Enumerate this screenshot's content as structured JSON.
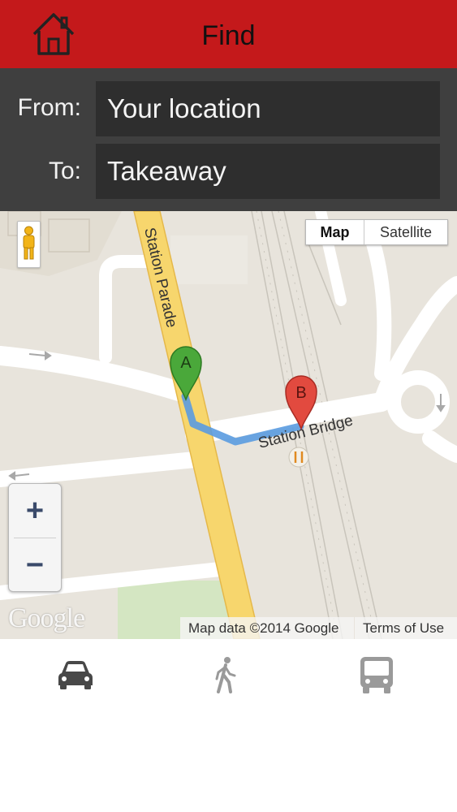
{
  "header": {
    "title": "Find",
    "home_icon": "home-icon",
    "color": "#c4191b"
  },
  "route": {
    "from_label": "From:",
    "from_value": "Your location",
    "to_label": "To:",
    "to_value": "Takeaway"
  },
  "map": {
    "map_type_selected": "Map",
    "map_type_options": [
      "Map",
      "Satellite"
    ],
    "street_labels": {
      "station_parade": "Station Parade",
      "station_bridge": "Station Bridge"
    },
    "markers": {
      "start": "A",
      "end": "B"
    },
    "zoom_in": "+",
    "zoom_out": "−",
    "logo": "Google",
    "attribution": "Map data ©2014 Google",
    "terms": "Terms of Use",
    "route_color": "#5a9be0",
    "marker_a_color": "#4aa83a",
    "marker_b_color": "#e24a3f"
  },
  "travel_modes": {
    "car_icon": "car-icon",
    "walk_icon": "walk-icon",
    "bus_icon": "bus-icon",
    "selected": "car"
  }
}
